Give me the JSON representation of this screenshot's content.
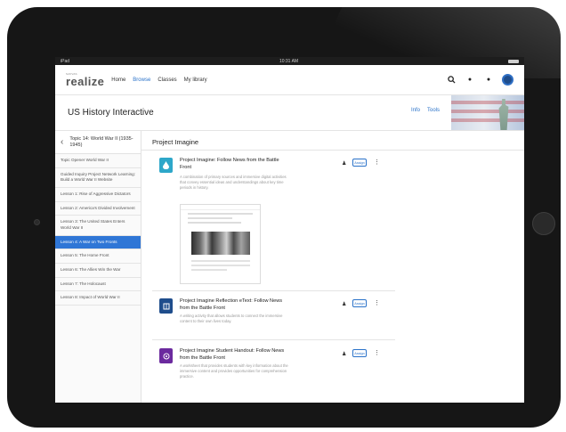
{
  "statusbar": {
    "left": "iPad",
    "center": "10:31 AM"
  },
  "brand": {
    "small": "SAVVAS",
    "name": "realize"
  },
  "topnav": {
    "items": [
      "Home",
      "Browse",
      "Classes",
      "My library"
    ]
  },
  "header": {
    "title": "US History Interactive",
    "actions": [
      "Info",
      "Tools"
    ]
  },
  "sidebar": {
    "topic": "Topic 14: World War II (1935-1945)",
    "items": [
      "Topic Opener World War II",
      "Guided Inquiry Project Network Learning: Build a World War II Website",
      "Lesson 1: Rise of Aggressive Dictators",
      "Lesson 2: America's Divided Involvement",
      "Lesson 3: The United States Enters World War II",
      "Lesson 4: A War on Two Fronts",
      "Lesson 5: The Home Front",
      "Lesson 6: The Allies Win the War",
      "Lesson 7: The Holocaust",
      "Lesson 8: Impact of World War II"
    ],
    "active_index": 5
  },
  "main": {
    "section_title": "Project Imagine",
    "cards": [
      {
        "title": "Project Imagine: Follow News from the Battle Front",
        "desc": "A combination of primary sources and immersive digital activities that convey essential ideas and understandings about key time periods in history.",
        "assign": "Assign",
        "color": "#2ea7c9",
        "icon": "drop-icon"
      },
      {
        "title": "Project Imagine Reflection eText: Follow News from the Battle Front",
        "desc": "A writing activity that allows students to connect the immersive content to their own lives today.",
        "assign": "Assign",
        "color": "#1f4d8c",
        "icon": "book-icon"
      },
      {
        "title": "Project Imagine Student Handout: Follow News from the Battle Front",
        "desc": "A worksheet that provides students with key information about the immersive content and provides opportunities for comprehension practice.",
        "assign": "Assign",
        "color": "#6b2a9e",
        "icon": "handout-icon"
      }
    ]
  }
}
